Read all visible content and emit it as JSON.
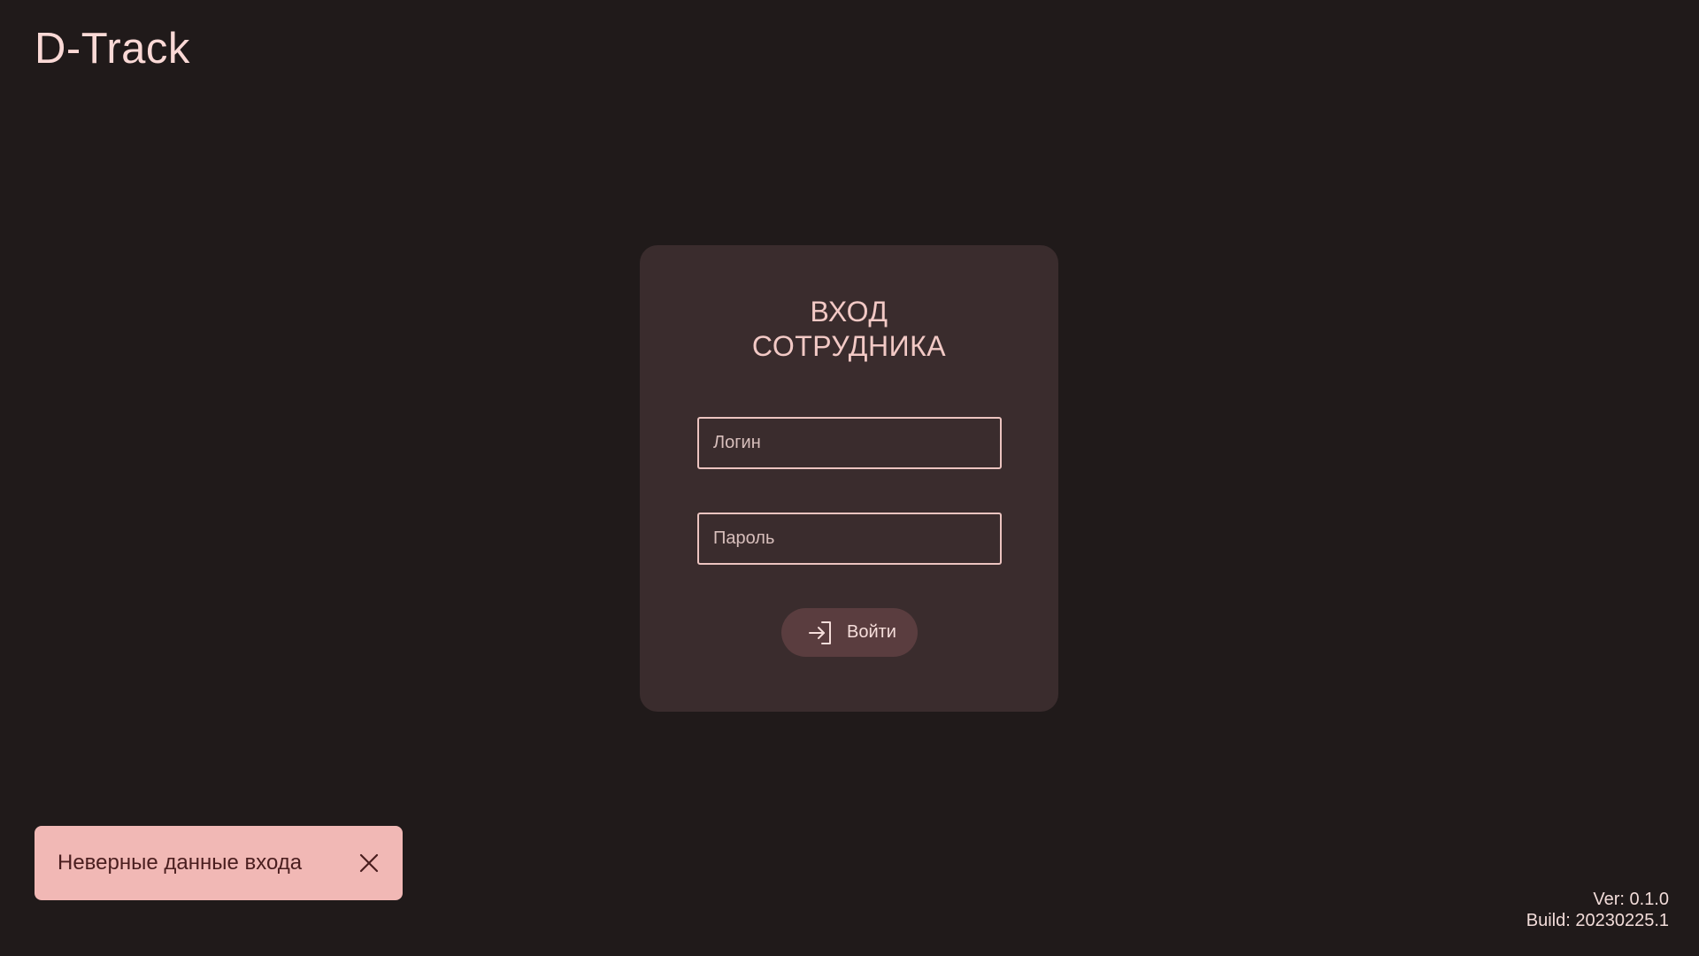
{
  "app": {
    "title": "D-Track"
  },
  "login_card": {
    "title_line1": "ВХОД",
    "title_line2": "СОТРУДНИКА",
    "login_field": {
      "placeholder": "Логин",
      "value": ""
    },
    "password_field": {
      "placeholder": "Пароль",
      "value": ""
    },
    "submit_button": {
      "label": "Войти",
      "icon": "login-icon"
    }
  },
  "snackbar": {
    "message": "Неверные данные входа",
    "close_icon": "close-icon"
  },
  "footer": {
    "version": "Ver: 0.1.0",
    "build": "Build: 20230225.1"
  },
  "colors": {
    "background": "#201a1a",
    "card": "#3a2c2d",
    "accent_text": "#fad9d6",
    "button": "#5a3d3f",
    "snackbar": "#f1b8b5",
    "snackbar_text": "#4a1e1f"
  }
}
